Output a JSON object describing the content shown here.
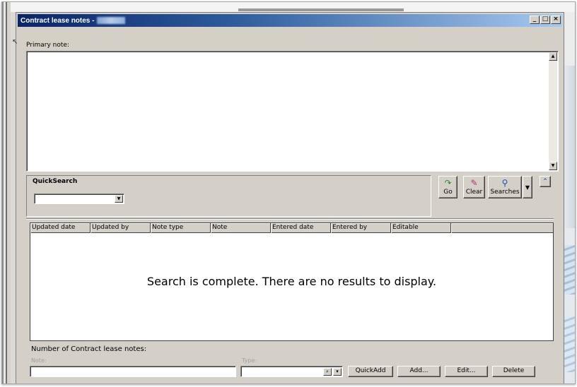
{
  "window": {
    "title": "Contract lease notes -",
    "minimize": "_",
    "maximize": "□",
    "close": "×"
  },
  "primary_note": {
    "label": "Primary note:",
    "value": ""
  },
  "quicksearch": {
    "title": "QuickSearch",
    "selected": ""
  },
  "toolbar": {
    "go_label": "Go",
    "clear_label": "Clear",
    "searches_label": "Searches"
  },
  "grid": {
    "columns": [
      "Updated date",
      "Updated by",
      "Note type",
      "Note",
      "Entered date",
      "Entered by",
      "Editable"
    ],
    "empty_message": "Search is complete. There are no results to display."
  },
  "footer": {
    "count_label": "Number of Contract lease notes:",
    "note_label": "Note:",
    "note_value": "",
    "type_label": "Type:",
    "type_value": "",
    "quickadd_label": "QuickAdd",
    "add_label": "Add...",
    "edit_label": "Edit...",
    "delete_label": "Delete"
  },
  "colors": {
    "titlebar_start": "#0a246a",
    "titlebar_end": "#a6caf0",
    "window_face": "#d4d0c8"
  }
}
